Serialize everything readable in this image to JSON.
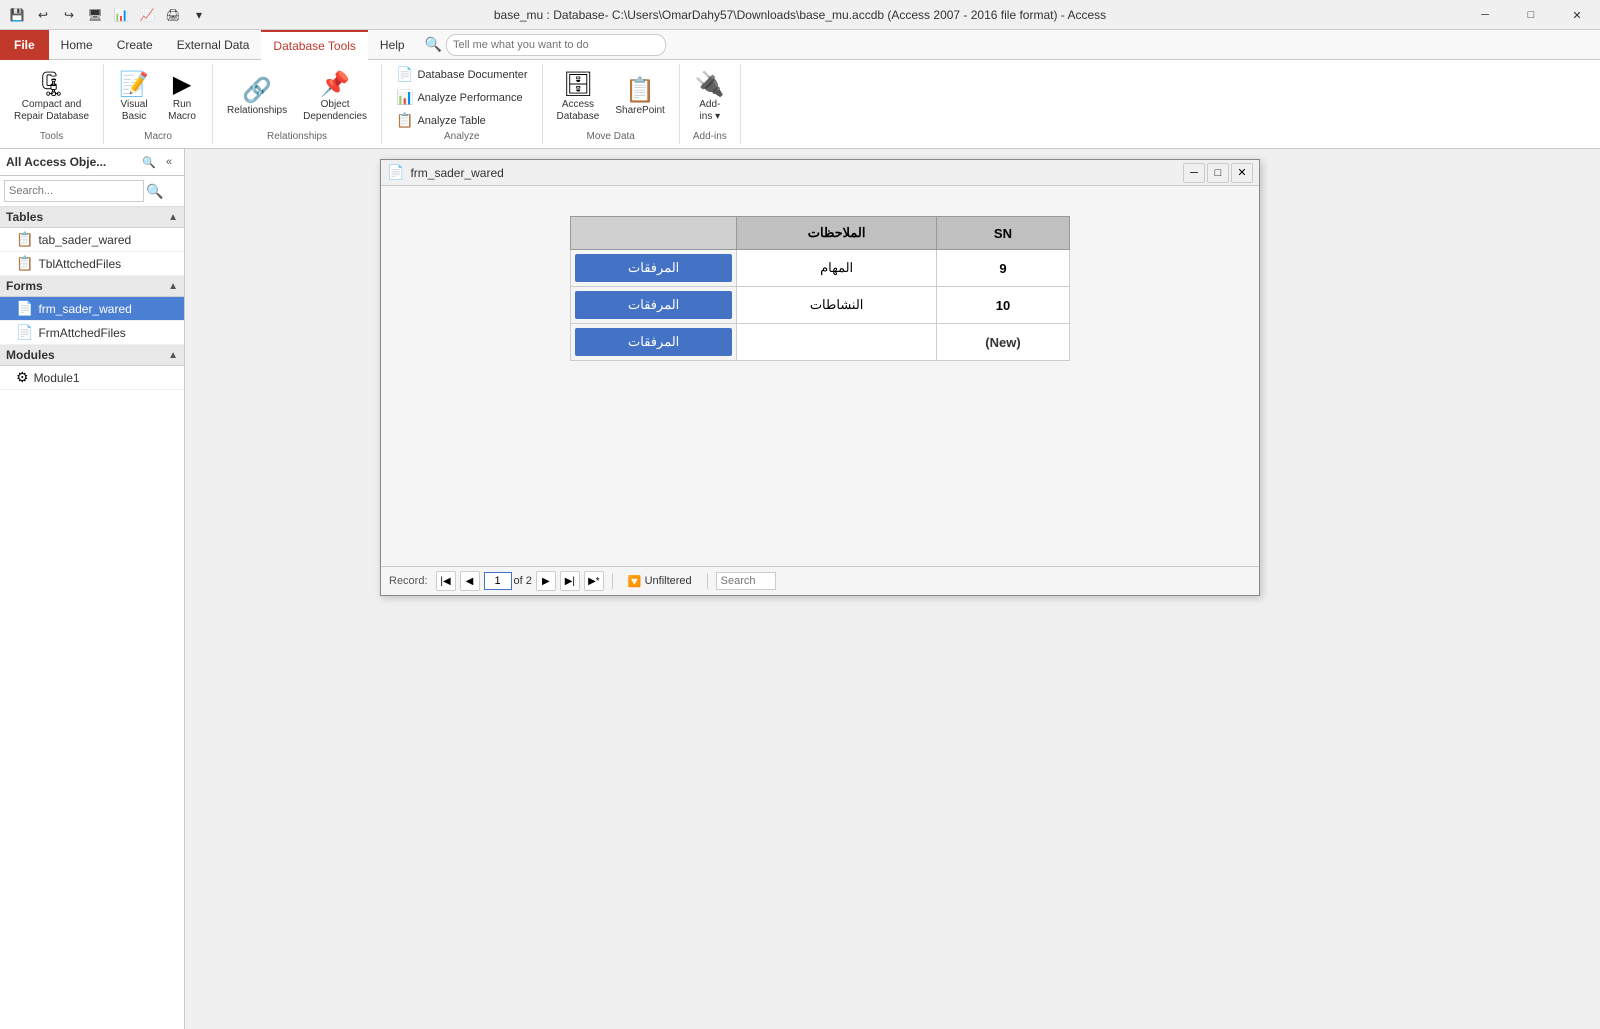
{
  "titlebar": {
    "title": "base_mu : Database- C:\\Users\\OmarDahy57\\Downloads\\base_mu.accdb (Access 2007 - 2016 file format) - Access"
  },
  "quickaccess": {
    "buttons": [
      "💾",
      "↩",
      "↪",
      "🖥",
      "📊",
      "📈",
      "🖨"
    ]
  },
  "ribbon": {
    "tabs": [
      {
        "label": "File",
        "active": false,
        "file": true
      },
      {
        "label": "Home",
        "active": false
      },
      {
        "label": "Create",
        "active": false
      },
      {
        "label": "External Data",
        "active": false
      },
      {
        "label": "Database Tools",
        "active": true
      },
      {
        "label": "Help",
        "active": false
      }
    ],
    "search_placeholder": "Tell me what you want to do",
    "groups": {
      "tools": {
        "label": "Tools",
        "compact_label": "Compact and\nRepair Database",
        "compact_icon": "🗜"
      },
      "macro": {
        "label": "Macro",
        "visual_basic_label": "Visual\nBasic",
        "visual_basic_icon": "📝",
        "run_macro_label": "Run\nMacro",
        "run_macro_icon": "▶"
      },
      "relationships": {
        "label": "Relationships",
        "relationships_label": "Relationships",
        "relationships_icon": "🔗",
        "object_dep_label": "Object\nDependencies",
        "object_dep_icon": "📌"
      },
      "analyze": {
        "label": "Analyze",
        "database_documenter": "Database Documenter",
        "analyze_performance": "Analyze Performance",
        "analyze_table": "Analyze Table"
      },
      "move_data": {
        "label": "Move Data",
        "access_database": "Access\nDatabase",
        "access_icon": "🗄",
        "sharepoint_label": "SharePoint",
        "sharepoint_icon": "📋"
      },
      "add_ins": {
        "label": "Add-ins",
        "add_ins_label": "Add-\nins",
        "add_ins_icon": "🔌"
      }
    }
  },
  "sidebar": {
    "title": "All Access Obje...",
    "search_placeholder": "Search...",
    "sections": {
      "tables": {
        "label": "Tables",
        "items": [
          {
            "label": "tab_sader_wared",
            "icon": "📋"
          },
          {
            "label": "TblAttchedFiles",
            "icon": "📋"
          }
        ]
      },
      "forms": {
        "label": "Forms",
        "items": [
          {
            "label": "frm_sader_wared",
            "icon": "📄",
            "active": true
          },
          {
            "label": "FrmAttchedFiles",
            "icon": "📄"
          }
        ]
      },
      "modules": {
        "label": "Modules",
        "items": [
          {
            "label": "Module1",
            "icon": "⚙"
          }
        ]
      }
    }
  },
  "mdi_window": {
    "title": "frm_sader_wared",
    "icon": "📄"
  },
  "table": {
    "headers": [
      {
        "label": "الملاحظات",
        "key": "notes"
      },
      {
        "label": "SN",
        "key": "sn"
      }
    ],
    "rows": [
      {
        "button": "المرفقات",
        "notes": "المهام",
        "sn": "9"
      },
      {
        "button": "المرفقات",
        "notes": "النشاطات",
        "sn": "10"
      },
      {
        "button": "المرفقات",
        "notes": "",
        "sn": "(New)"
      }
    ]
  },
  "record_nav": {
    "label": "Record:",
    "current": "1",
    "total_label": "of 2",
    "filter_label": "Unfiltered",
    "search_label": "Search"
  }
}
